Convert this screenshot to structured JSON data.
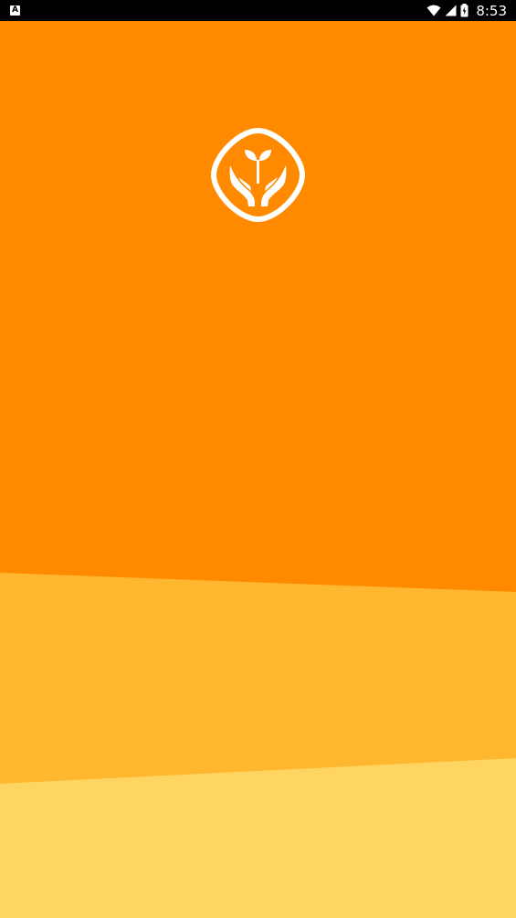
{
  "status_bar": {
    "notification_icon": "app-notification-icon",
    "notification_letter": "A",
    "wifi_icon": "wifi-icon",
    "signal_icon": "cellular-signal-icon",
    "battery_icon": "battery-charging-icon",
    "time": "8:53"
  },
  "splash": {
    "logo_icon": "hands-holding-sprout-icon",
    "colors": {
      "primary": "#ff8a00",
      "middle_band": "#ffb72f",
      "bottom_band": "#ffd561",
      "logo": "#ffffff",
      "status_bar": "#000000"
    }
  }
}
